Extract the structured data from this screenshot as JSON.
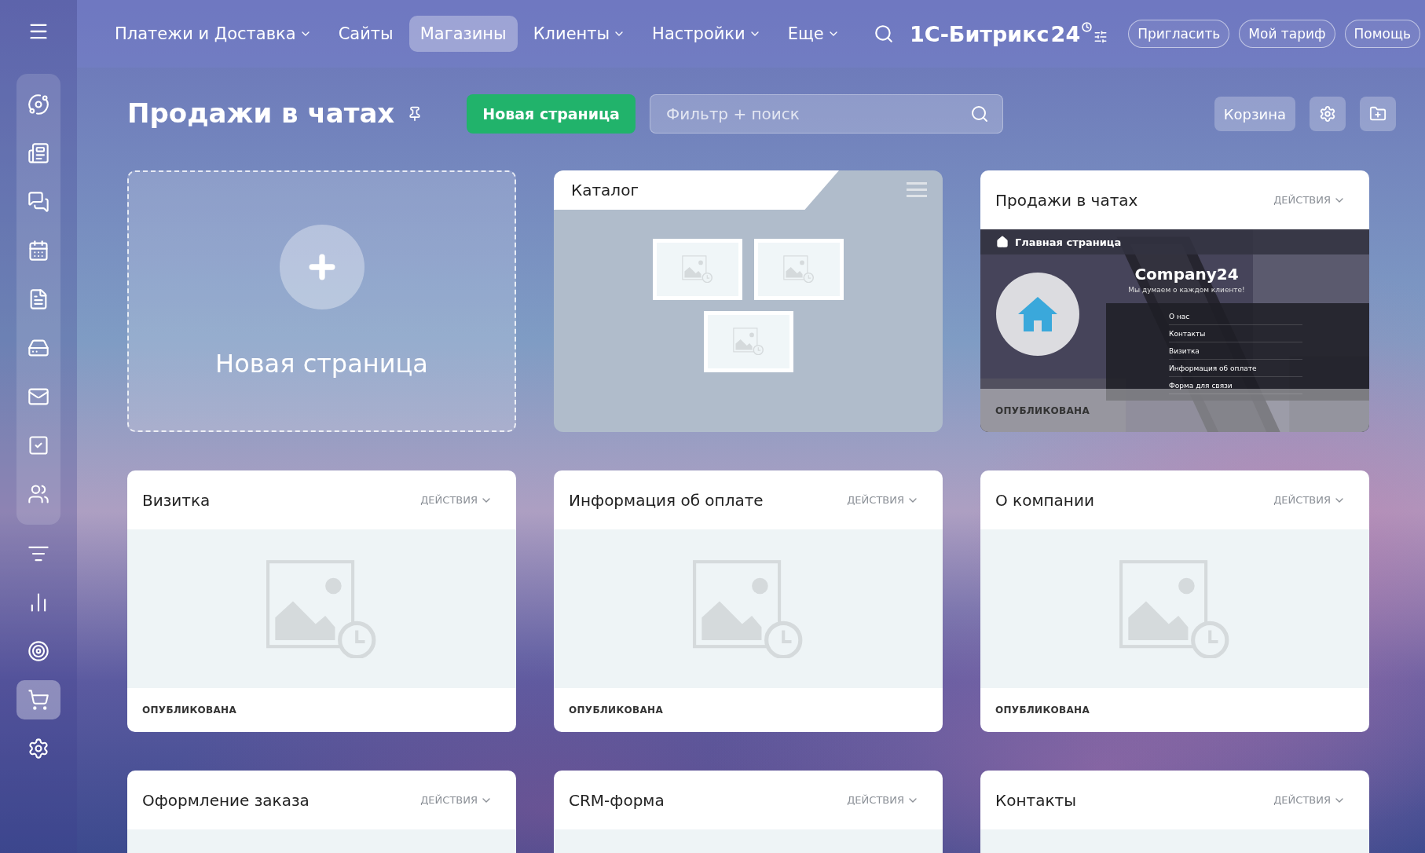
{
  "topbar": {
    "nav": [
      {
        "label": "Платежи и Доставка",
        "selected": false,
        "dropdown": true
      },
      {
        "label": "Сайты",
        "selected": false,
        "dropdown": false
      },
      {
        "label": "Магазины",
        "selected": true,
        "dropdown": false
      },
      {
        "label": "Клиенты",
        "selected": false,
        "dropdown": true
      },
      {
        "label": "Настройки",
        "selected": false,
        "dropdown": true
      },
      {
        "label": "Еще",
        "selected": false,
        "dropdown": true
      }
    ],
    "brand": {
      "name": "1С-Битрикс",
      "number": "24"
    },
    "buttons": [
      "Пригласить",
      "Мой тариф",
      "Помощь"
    ]
  },
  "sidebar": {
    "items": [
      {
        "selected": false
      },
      {
        "selected": false
      },
      {
        "selected": false
      },
      {
        "selected": false
      },
      {
        "selected": false
      },
      {
        "selected": false
      },
      {
        "selected": false
      },
      {
        "selected": false
      },
      {
        "selected": false
      },
      {
        "selected": false
      },
      {
        "selected": false
      },
      {
        "selected": false
      },
      {
        "selected": true
      },
      {
        "selected": false
      }
    ]
  },
  "header": {
    "title": "Продажи в чатах",
    "new_button": "Новая страница",
    "search": {
      "placeholder": "Фильтр + поиск"
    },
    "basket_button": "Корзина"
  },
  "cards": [
    {
      "kind": "new",
      "label": "Новая страница"
    },
    {
      "kind": "catalog",
      "title": "Каталог"
    },
    {
      "kind": "preview",
      "title": "Продажи в чатах",
      "actions": "ДЕЙСТВИЯ",
      "status": "ОПУБЛИКОВАНА",
      "preview": {
        "nav_title": "Главная страница",
        "company": "Company24",
        "tagline": "Мы думаем о каждом клиенте!",
        "menu": [
          "О нас",
          "Контакты",
          "Визитка",
          "Информация об оплате",
          "Форма для связи"
        ]
      }
    },
    {
      "kind": "page",
      "title": "Визитка",
      "actions": "ДЕЙСТВИЯ",
      "placeholder": true,
      "status": "ОПУБЛИКОВАНА"
    },
    {
      "kind": "page",
      "title": "Информация об оплате",
      "actions": "ДЕЙСТВИЯ",
      "placeholder": true,
      "status": "ОПУБЛИКОВАНА"
    },
    {
      "kind": "page",
      "title": "О компании",
      "actions": "ДЕЙСТВИЯ",
      "placeholder": true,
      "status": "ОПУБЛИКОВАНА"
    },
    {
      "kind": "page",
      "title": "Оформление заказа",
      "actions": "ДЕЙСТВИЯ"
    },
    {
      "kind": "page",
      "title": "CRM-форма",
      "actions": "ДЕЙСТВИЯ"
    },
    {
      "kind": "page",
      "title": "Контакты",
      "actions": "ДЕЙСТВИЯ"
    }
  ]
}
